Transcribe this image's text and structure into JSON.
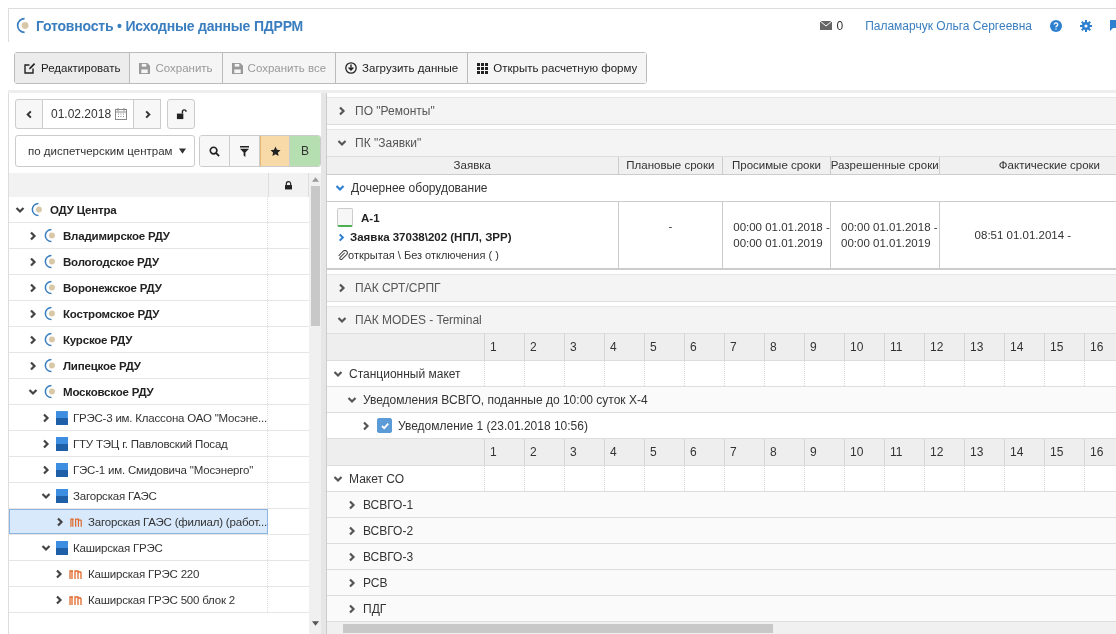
{
  "header": {
    "title": "Готовность • Исходные данные ПДРРМ",
    "mail_count": "0",
    "user": "Паламарчук Ольга Сергеевна"
  },
  "toolbar": [
    {
      "kind": "edit",
      "label": "Редактировать",
      "disabled": false
    },
    {
      "kind": "save",
      "label": "Сохранить",
      "disabled": true
    },
    {
      "kind": "save",
      "label": "Сохранить все",
      "disabled": true
    },
    {
      "kind": "download",
      "label": "Загрузить данные",
      "disabled": false
    },
    {
      "kind": "grid",
      "label": "Открыть расчетную форму",
      "disabled": false
    }
  ],
  "left": {
    "date": "01.02.2018",
    "grouping": "по диспетчерским центрам",
    "tools": [
      {
        "kind": "search",
        "selected": false
      },
      {
        "kind": "filter",
        "selected": false
      },
      {
        "kind": "star",
        "selected": true
      },
      {
        "kind": "letter",
        "label": "В",
        "selected": true
      }
    ],
    "tree": [
      {
        "label": "ОДУ Центра",
        "kind": "center",
        "expanded": true,
        "selected": false,
        "children": [
          {
            "label": "Владимирское РДУ",
            "kind": "center",
            "expanded": false,
            "selected": false
          },
          {
            "label": "Вологодское РДУ",
            "kind": "center",
            "expanded": false,
            "selected": false
          },
          {
            "label": "Воронежское РДУ",
            "kind": "center",
            "expanded": false,
            "selected": false
          },
          {
            "label": "Костромское РДУ",
            "kind": "center",
            "expanded": false,
            "selected": false
          },
          {
            "label": "Курское РДУ",
            "kind": "center",
            "expanded": false,
            "selected": false
          },
          {
            "label": "Липецкое РДУ",
            "kind": "center",
            "expanded": false,
            "selected": false
          },
          {
            "label": "Московское РДУ",
            "kind": "center",
            "expanded": true,
            "selected": false,
            "children": [
              {
                "label": "ГРЭС-3 им. Классона ОАО \"Мосэне...",
                "kind": "station",
                "expanded": false,
                "selected": false
              },
              {
                "label": "ГТУ ТЭЦ г. Павловский Посад",
                "kind": "station",
                "expanded": false,
                "selected": false
              },
              {
                "label": "ГЭС-1 им. Смидовича \"Мосэнерго\"",
                "kind": "station",
                "expanded": false,
                "selected": false
              },
              {
                "label": "Загорская ГАЭС",
                "kind": "station",
                "expanded": true,
                "selected": false,
                "children": [
                  {
                    "label": "Загорская ГАЭС (филиал) (работ...",
                    "kind": "unit",
                    "expanded": false,
                    "selected": true
                  }
                ]
              },
              {
                "label": "Каширская ГРЭС",
                "kind": "station",
                "expanded": true,
                "selected": false,
                "children": [
                  {
                    "label": "Каширская ГРЭС 220",
                    "kind": "unit",
                    "expanded": false,
                    "selected": false
                  },
                  {
                    "label": "Каширская ГРЭС 500 блок 2",
                    "kind": "unit",
                    "expanded": false,
                    "selected": false
                  }
                ]
              }
            ]
          }
        ]
      }
    ]
  },
  "sections": [
    {
      "title": "ПО \"Ремонты\"",
      "expanded": false
    },
    {
      "title": "ПК \"Заявки\"",
      "expanded": true,
      "requests": {
        "columns": [
          "Заявка",
          "Плановые сроки",
          "Просимые сроки",
          "Разрешенные сроки",
          "Фактические сроки"
        ],
        "group": {
          "label": "Дочернее оборудование",
          "expanded": true
        },
        "rows": [
          {
            "cells": [
              {
                "name": "А-1",
                "checked": false,
                "request": "Заявка 37038\\202 (НПЛ, ЗРР)",
                "status": "открытая \\ Без отключения ( )"
              },
              [
                "-"
              ],
              [
                "00:00 01.01.2018 -",
                "00:00 01.01.2019"
              ],
              [
                "00:00 01.01.2018 -",
                "00:00 01.01.2019"
              ],
              [
                "08:51 01.01.2014 -"
              ]
            ]
          }
        ]
      }
    },
    {
      "title": "ПАК СРТ/СРПГ",
      "expanded": false
    },
    {
      "title": "ПАК MODES - Terminal",
      "expanded": true,
      "blocks": [
        {
          "hours": [
            "1",
            "2",
            "3",
            "4",
            "5",
            "6",
            "7",
            "8",
            "9",
            "10",
            "11",
            "12",
            "13",
            "14",
            "15",
            "16"
          ],
          "rows": [
            {
              "label": "Станционный макет",
              "expanded": true,
              "children": [
                {
                  "label": "Уведомления ВСВГО, поданные до 10:00 суток Х-4",
                  "expanded": true,
                  "children": [
                    {
                      "label": "Уведомление 1 (23.01.2018 10:56)",
                      "expanded": false,
                      "checked": true
                    }
                  ]
                }
              ]
            }
          ]
        },
        {
          "hours": [
            "1",
            "2",
            "3",
            "4",
            "5",
            "6",
            "7",
            "8",
            "9",
            "10",
            "11",
            "12",
            "13",
            "14",
            "15",
            "16"
          ],
          "rows": [
            {
              "label": "Макет СО",
              "expanded": true,
              "children": [
                {
                  "label": "ВСВГО-1",
                  "expanded": false
                },
                {
                  "label": "ВСВГО-2",
                  "expanded": false
                },
                {
                  "label": "ВСВГО-3",
                  "expanded": false
                },
                {
                  "label": "РСВ",
                  "expanded": false
                },
                {
                  "label": "ПДГ",
                  "expanded": false
                }
              ]
            }
          ]
        }
      ]
    }
  ]
}
